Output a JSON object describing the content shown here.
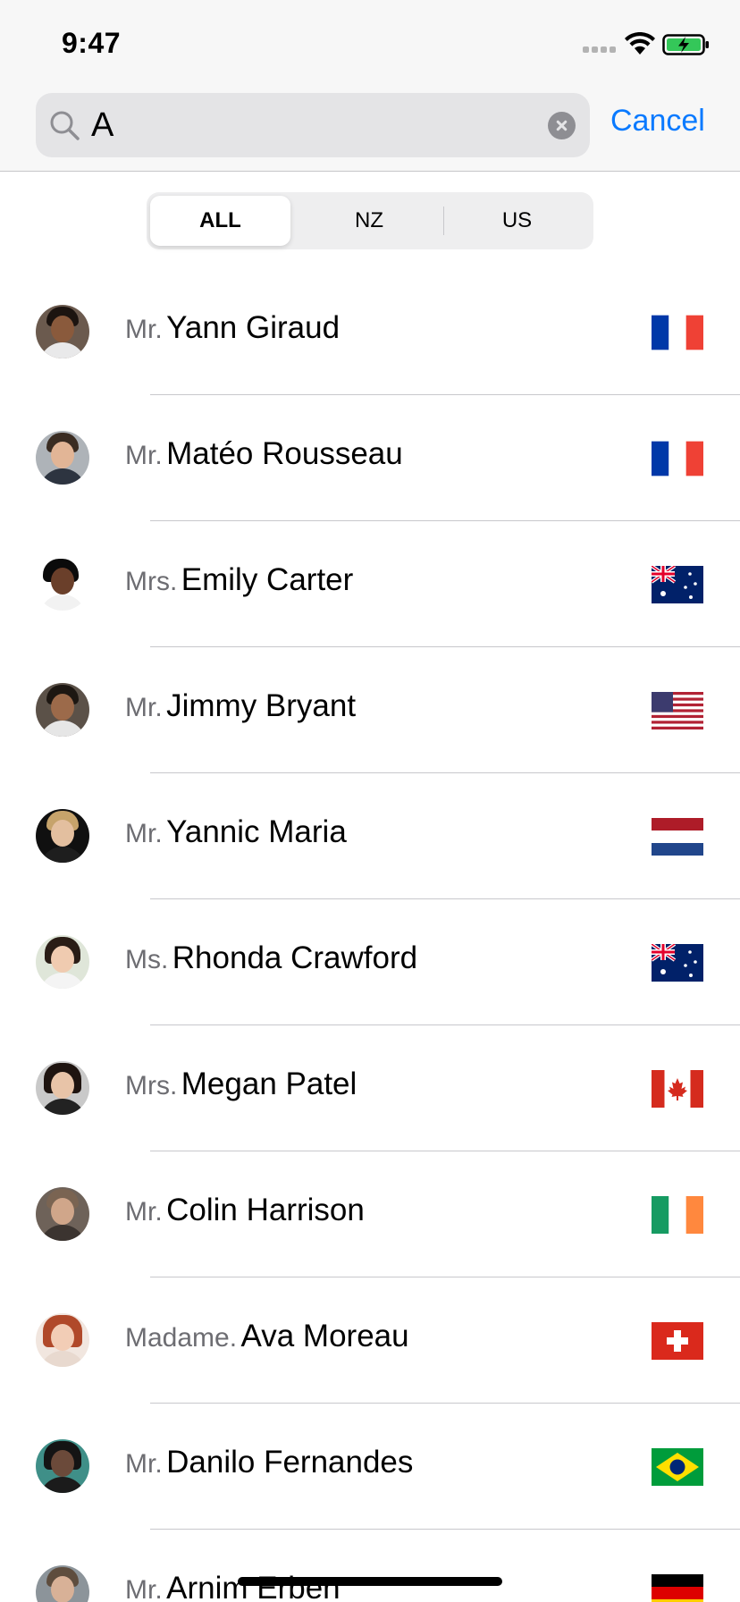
{
  "status_bar": {
    "time": "9:47"
  },
  "search": {
    "value": "A",
    "cancel_label": "Cancel"
  },
  "segments": [
    {
      "label": "ALL",
      "selected": true
    },
    {
      "label": "NZ",
      "selected": false
    },
    {
      "label": "US",
      "selected": false
    }
  ],
  "people": [
    {
      "title": "Mr.",
      "name": "Yann Giraud",
      "flag": "france-flag-icon"
    },
    {
      "title": "Mr.",
      "name": "Matéo Rousseau",
      "flag": "france-flag-icon"
    },
    {
      "title": "Mrs.",
      "name": "Emily Carter",
      "flag": "australia-flag-icon"
    },
    {
      "title": "Mr.",
      "name": "Jimmy Bryant",
      "flag": "usa-flag-icon"
    },
    {
      "title": "Mr.",
      "name": "Yannic Maria",
      "flag": "netherlands-flag-icon"
    },
    {
      "title": "Ms.",
      "name": "Rhonda Crawford",
      "flag": "australia-flag-icon"
    },
    {
      "title": "Mrs.",
      "name": "Megan Patel",
      "flag": "canada-flag-icon"
    },
    {
      "title": "Mr.",
      "name": "Colin Harrison",
      "flag": "ireland-flag-icon"
    },
    {
      "title": "Madame.",
      "name": "Ava Moreau",
      "flag": "switzerland-flag-icon"
    },
    {
      "title": "Mr.",
      "name": "Danilo Fernandes",
      "flag": "brazil-flag-icon"
    },
    {
      "title": "Mr.",
      "name": "Arnim Erben",
      "flag": "germany-flag-icon"
    }
  ],
  "colors": {
    "accent": "#0a7aff",
    "caret": "#2f6df6",
    "secondary_text": "#6d6d72"
  }
}
